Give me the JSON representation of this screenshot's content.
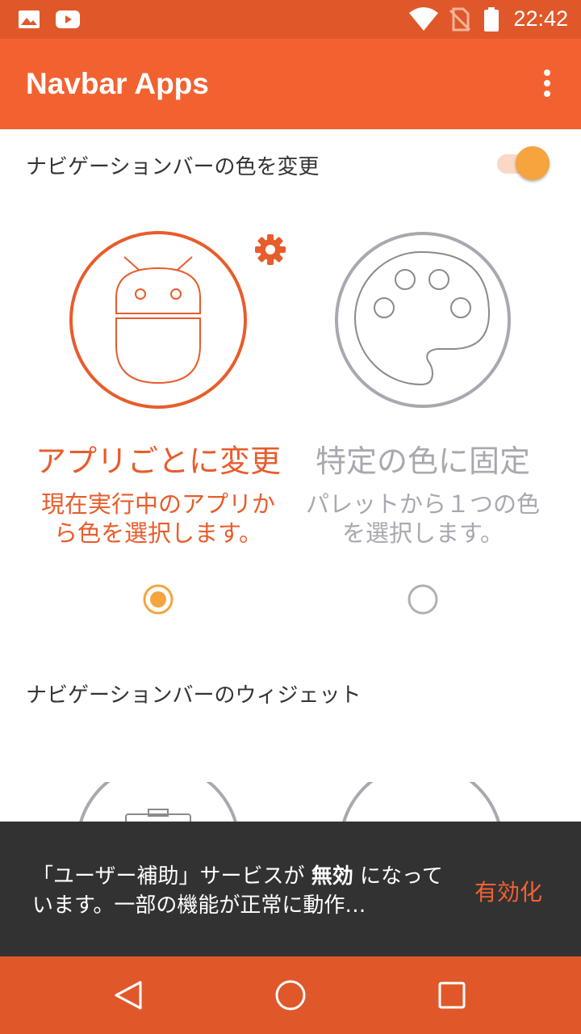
{
  "status_bar": {
    "time": "22:42",
    "icons": [
      "image-icon",
      "youtube-icon",
      "wifi-icon",
      "no-sim-icon",
      "battery-icon"
    ]
  },
  "app_bar": {
    "title": "Navbar Apps",
    "menu_icon": "more-vert-icon"
  },
  "colors": {
    "accent": "#F26230",
    "status_bar": "#E0582A",
    "switch_thumb": "#F5A43E",
    "inactive": "#A8A8B0"
  },
  "color_section": {
    "label": "ナビゲーションバーの色を変更",
    "toggle_on": true,
    "options": [
      {
        "title": "アプリごとに変更",
        "desc_line1": "現在実行中のアプリか",
        "desc_line2": "ら色を選択します。",
        "selected": true,
        "icon": "android-icon",
        "settings_icon": "gear-icon"
      },
      {
        "title": "特定の色に固定",
        "desc_line1": "パレットから１つの色",
        "desc_line2": "を選択します。",
        "selected": false,
        "icon": "palette-icon"
      }
    ]
  },
  "widget_section": {
    "label": "ナビゲーションバーのウィジェット"
  },
  "snackbar": {
    "text_pre": "「ユーザー補助」サービスが ",
    "text_bold": "無効",
    "text_post": " になっています。一部の機能が正常に動作…",
    "action": "有効化"
  },
  "nav_bar": {
    "buttons": [
      "back-icon",
      "home-icon",
      "recents-icon"
    ]
  }
}
